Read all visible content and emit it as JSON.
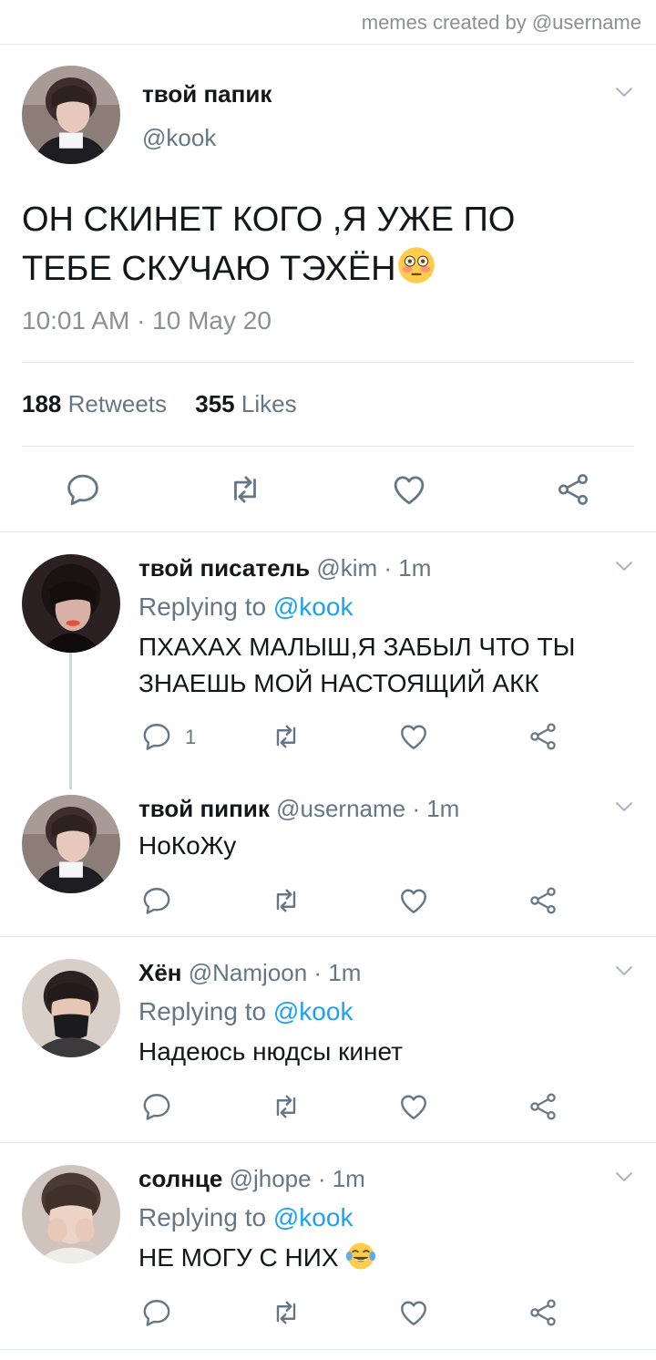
{
  "watermark": "memes created by @username",
  "main_tweet": {
    "name": "твой папик",
    "handle": "@kook",
    "text": "ОН СКИНЕТ КОГО ,Я УЖЕ ПО ТЕБЕ СКУЧАЮ ТЭХЁН",
    "emoji": "flushed-face",
    "timestamp": "10:01 AM · 10 May 20",
    "retweets_count": "188",
    "retweets_label": "Retweets",
    "likes_count": "355",
    "likes_label": "Likes"
  },
  "replies": [
    {
      "name": "твой писатель",
      "meta": "@kim · 1m",
      "replying_prefix": "Replying to",
      "replying_handle": "@kook",
      "text_line1": "ПХАХАХ МАЛЫШ,Я ЗАБЫЛ ЧТО ТЫ",
      "text_line2": "ЗНАЕШЬ МОЙ  НАСТОЯЩИЙ АКК",
      "reply_count": "1"
    },
    {
      "name": "твой пипик",
      "meta": "@username · 1m",
      "text_line1": "НоКоЖу"
    },
    {
      "name": "Хён",
      "meta": "@Namjoon · 1m",
      "replying_prefix": "Replying to",
      "replying_handle": "@kook",
      "text_line1": "Надеюсь нюдсы кинет"
    },
    {
      "name": "солнце",
      "meta": "@jhope · 1m",
      "replying_prefix": "Replying to",
      "replying_handle": "@kook",
      "text_line1": "НЕ МОГУ С НИХ",
      "emoji": "tears-of-joy-face"
    }
  ],
  "colors": {
    "text": "#14171a",
    "secondary": "#657786",
    "link": "#1da1f2",
    "divider": "#e1e8ed",
    "icon": "#657786"
  },
  "icons": [
    "reply-icon",
    "retweet-icon",
    "like-icon",
    "share-icon",
    "chevron-down-icon"
  ]
}
